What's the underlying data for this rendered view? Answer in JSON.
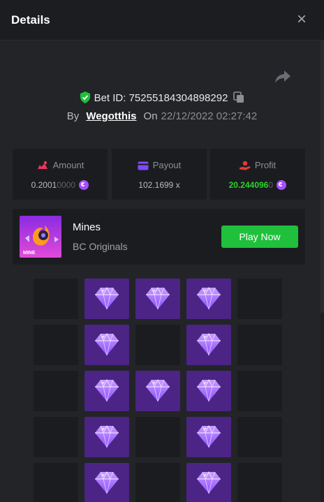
{
  "header": {
    "title": "Details"
  },
  "bet": {
    "label": "Bet ID: ",
    "id": "75255184304898292"
  },
  "byline": {
    "by": "By",
    "user": "Wegotthis",
    "on": "On",
    "date": "22/12/2022 02:27:42"
  },
  "stats": {
    "amount": {
      "label": "Amount",
      "value": "0.2001",
      "value_trailing": "0000"
    },
    "payout": {
      "label": "Payout",
      "value": "102.1699 x"
    },
    "profit": {
      "label": "Profit",
      "value": "20.244096",
      "value_trailing": "0"
    }
  },
  "game": {
    "name": "Mines",
    "provider": "BC Originals",
    "thumb_text": "MINE",
    "play_label": "Play Now"
  },
  "board": {
    "columns": 5,
    "rows_visible": 5,
    "cells": [
      [
        "empty",
        "gem",
        "gem",
        "gem",
        "empty"
      ],
      [
        "empty",
        "gem",
        "empty",
        "gem",
        "empty"
      ],
      [
        "empty",
        "gem",
        "gem",
        "gem",
        "empty"
      ],
      [
        "empty",
        "gem",
        "empty",
        "gem",
        "empty"
      ],
      [
        "empty",
        "gem",
        "empty",
        "gem",
        "empty"
      ]
    ]
  },
  "colors": {
    "accent_green": "#1fc03c",
    "profit_green": "#2bd42f",
    "gem_tile": "#4b2485",
    "coin_purple": "#a64dff"
  },
  "icons": {
    "close": "close-icon",
    "share": "share-icon",
    "verified": "shield-check-icon",
    "copy": "copy-icon",
    "amount": "bet-amount-icon",
    "payout": "wallet-icon",
    "profit": "profit-hand-icon",
    "gem": "diamond-icon"
  }
}
